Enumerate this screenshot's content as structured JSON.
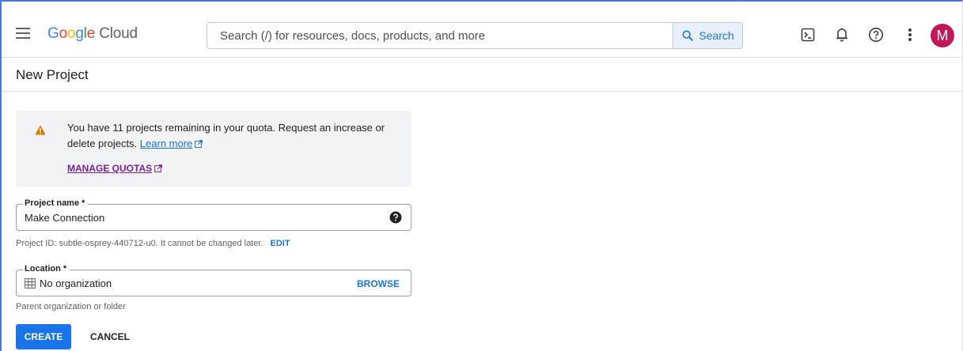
{
  "header": {
    "brand_google": "Google",
    "brand_cloud": "Cloud",
    "search": {
      "placeholder": "Search (/) for resources, docs, products, and more",
      "button_label": "Search"
    },
    "icons": [
      "cloud-shell-icon",
      "bell-icon",
      "help-icon",
      "more-vert-icon"
    ],
    "avatar_initial": "M",
    "avatar_color": "#c2185b"
  },
  "page": {
    "title": "New Project"
  },
  "quota_notice": {
    "text": "You have 11 projects remaining in your quota. Request an increase or delete projects.",
    "learn_more": "Learn more",
    "manage_quotas": "MANAGE QUOTAS"
  },
  "form": {
    "project_name": {
      "label": "Project name *",
      "value": "Make Connection"
    },
    "project_id_hint": "Project ID: subtle-osprey-440712-u0. It cannot be changed later.",
    "edit_label": "EDIT",
    "location": {
      "label": "Location *",
      "value": "No organization",
      "browse_label": "BROWSE"
    },
    "location_hint": "Parent organization or folder"
  },
  "actions": {
    "create": "CREATE",
    "cancel": "CANCEL"
  },
  "colors": {
    "accent": "#1a73e8",
    "warning": "#e37400",
    "manage_link": "#7b1fa2"
  }
}
